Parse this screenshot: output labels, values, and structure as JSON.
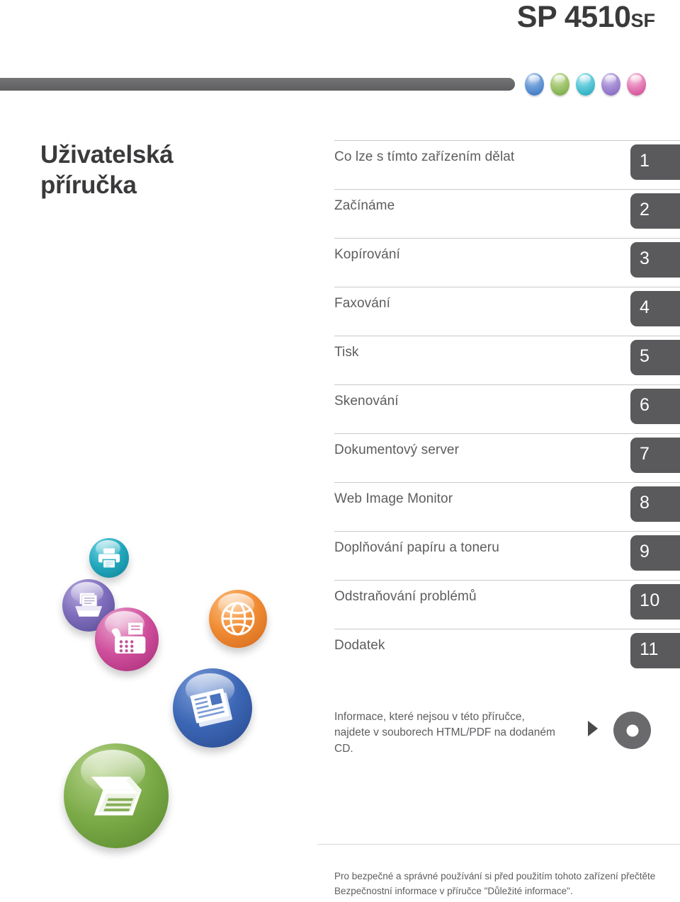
{
  "header": {
    "model": "SP 4510",
    "model_suffix": "SF",
    "accent_dots": [
      {
        "name": "dot-blue",
        "color": "#2e6fc0"
      },
      {
        "name": "dot-green",
        "color": "#6fa33c"
      },
      {
        "name": "dot-teal",
        "color": "#17a7b8"
      },
      {
        "name": "dot-purple",
        "color": "#7e60bd"
      },
      {
        "name": "dot-pink",
        "color": "#cf3f8f"
      }
    ],
    "bar_color": "#6a6a6d"
  },
  "guide": {
    "title_line1": "Uživatelská",
    "title_line2": "příručka"
  },
  "chapters": [
    {
      "number": "1",
      "label": "Co lze s tímto zařízením dělat"
    },
    {
      "number": "2",
      "label": "Začínáme"
    },
    {
      "number": "3",
      "label": "Kopírování"
    },
    {
      "number": "4",
      "label": "Faxování"
    },
    {
      "number": "5",
      "label": "Tisk"
    },
    {
      "number": "6",
      "label": "Skenování"
    },
    {
      "number": "7",
      "label": "Dokumentový server"
    },
    {
      "number": "8",
      "label": "Web Image Monitor"
    },
    {
      "number": "9",
      "label": "Doplňování papíru a toneru"
    },
    {
      "number": "10",
      "label": "Odstraňování problémů"
    },
    {
      "number": "11",
      "label": "Dodatek"
    }
  ],
  "cd_note": {
    "text": "Informace, které nejsou v této příručce, najdete v souborech HTML/PDF na dodaném CD.",
    "arrow_icon": "triangle-right-icon",
    "disc_icon": "cd-disc-icon"
  },
  "footer": {
    "line1": "Pro bezpečné a správné používání si před použitím tohoto zařízení",
    "line2": "přečtěte Bezpečnostní informace v příručce \"Důležité informace\"."
  },
  "decorative_orbs": [
    {
      "name": "orb-printer-icon",
      "icon": "printer-icon",
      "color": "#22a8bd"
    },
    {
      "name": "orb-tray-icon",
      "icon": "paper-tray-icon",
      "color": "#7d6cbb"
    },
    {
      "name": "orb-fax-icon",
      "icon": "fax-icon",
      "color": "#cf4f9c"
    },
    {
      "name": "orb-globe-icon",
      "icon": "globe-icon",
      "color": "#f08b33"
    },
    {
      "name": "orb-doc-icon",
      "icon": "document-icon",
      "color": "#3c67b5"
    },
    {
      "name": "orb-scan-icon",
      "icon": "scanner-icon",
      "color": "#7cab48"
    }
  ]
}
